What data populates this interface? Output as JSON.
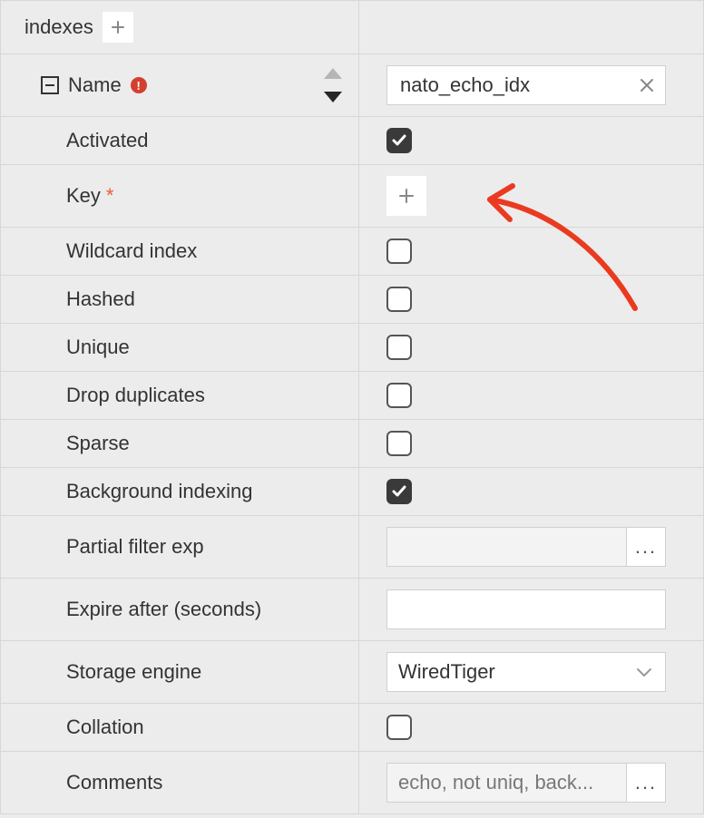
{
  "header": {
    "title": "indexes"
  },
  "name_row": {
    "label": "Name",
    "value": "nato_echo_idx"
  },
  "key_label": "Key",
  "props": {
    "activated": {
      "label": "Activated",
      "checked": true
    },
    "wildcard": {
      "label": "Wildcard index",
      "checked": false
    },
    "hashed": {
      "label": "Hashed",
      "checked": false
    },
    "unique": {
      "label": "Unique",
      "checked": false
    },
    "dropdup": {
      "label": "Drop duplicates",
      "checked": false
    },
    "sparse": {
      "label": "Sparse",
      "checked": false
    },
    "background": {
      "label": "Background indexing",
      "checked": true
    },
    "collation": {
      "label": "Collation",
      "checked": false
    }
  },
  "partial_filter": {
    "label": "Partial filter exp",
    "value": ""
  },
  "expire_after": {
    "label": "Expire after (seconds)",
    "value": ""
  },
  "storage_engine": {
    "label": "Storage engine",
    "selected": "WiredTiger"
  },
  "comments": {
    "label": "Comments",
    "value": "echo, not uniq, back..."
  },
  "ellipsis": "...",
  "alert_glyph": "!"
}
